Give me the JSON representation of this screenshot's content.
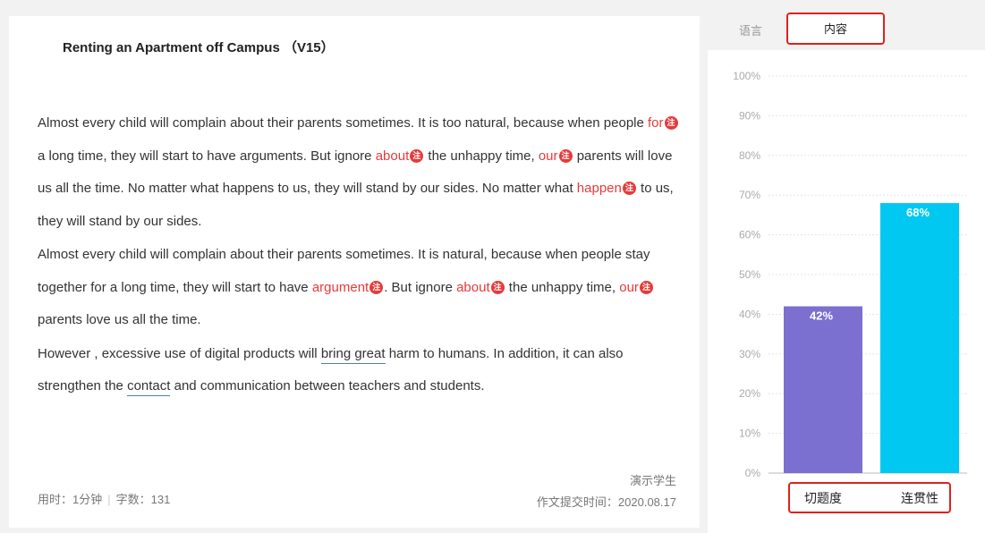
{
  "essay": {
    "title": "Renting an Apartment off Campus （V15）",
    "paragraphs": [
      [
        {
          "t": "Almost every child will complain about their parents sometimes. It is too natural, because when people "
        },
        {
          "t": "for",
          "err": true
        },
        {
          "icon": true
        },
        {
          "t": " a long time, they will start to have arguments. But ignore "
        },
        {
          "t": "about",
          "err": true
        },
        {
          "icon": true
        },
        {
          "t": " the unhappy time, "
        },
        {
          "t": "our",
          "err": true
        },
        {
          "icon": true
        },
        {
          "t": " parents will love us all the time. No matter what happens to us, they will stand by our sides. No matter what "
        },
        {
          "t": "happen",
          "err": true
        },
        {
          "icon": true
        },
        {
          "t": " to us, they will stand by our sides."
        }
      ],
      [
        {
          "t": "Almost every child will complain about their parents sometimes. It is natural, because when people stay together for a long time, they will start to have "
        },
        {
          "t": "argument",
          "err": true
        },
        {
          "icon": true
        },
        {
          "t": ". But ignore "
        },
        {
          "t": "about",
          "err": true
        },
        {
          "icon": true
        },
        {
          "t": " the unhappy time, "
        },
        {
          "t": "our",
          "err": true
        },
        {
          "icon": true
        },
        {
          "t": " parents love us all the time."
        }
      ],
      [
        {
          "t": "However , excessive use of digital products will "
        },
        {
          "t": "bring great",
          "u": true
        },
        {
          "t": " harm to humans. In addition, it can also strengthen the "
        },
        {
          "t": "contact",
          "u": true
        },
        {
          "t": " and communication between teachers and students."
        }
      ]
    ],
    "note_glyph": "注",
    "time_used": "用时：1分钟",
    "word_count": "字数：131",
    "author": "演示学生",
    "submit_time": "作文提交时间：2020.08.17"
  },
  "tabs": {
    "language": "语言",
    "content": "内容"
  },
  "chart_data": {
    "type": "bar",
    "categories": [
      "切题度",
      "连贯性"
    ],
    "values": [
      42,
      68
    ],
    "value_labels": [
      "42%",
      "68%"
    ],
    "colors": [
      "#7b6fcf",
      "#00c8f0"
    ],
    "ylim": [
      0,
      100
    ],
    "yticks": [
      "0%",
      "10%",
      "20%",
      "30%",
      "40%",
      "50%",
      "60%",
      "70%",
      "80%",
      "90%",
      "100%"
    ],
    "grid": true
  }
}
